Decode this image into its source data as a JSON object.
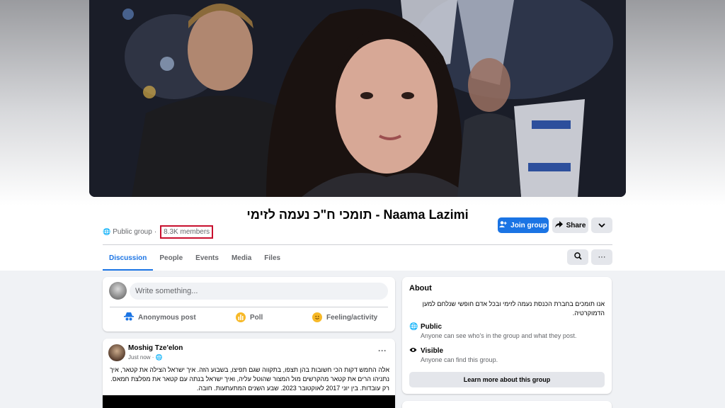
{
  "header": {
    "group_title": "תומכי ח\"כ נעמה לזימי - Naama Lazimi",
    "privacy": "Public group",
    "members": "8.3K members",
    "join_label": "Join group",
    "share_label": "Share"
  },
  "tabs": [
    {
      "label": "Discussion",
      "active": true
    },
    {
      "label": "People"
    },
    {
      "label": "Events"
    },
    {
      "label": "Media"
    },
    {
      "label": "Files"
    }
  ],
  "composer": {
    "placeholder": "Write something...",
    "actions": {
      "anonymous": "Anonymous post",
      "poll": "Poll",
      "feeling": "Feeling/activity"
    }
  },
  "post": {
    "author": "Moshig Tze'elon",
    "time": "Just now · ",
    "text": "אלה החמש דקות הכי חשובות בהן תצפו, בתקווה שגם תפיצו, בשבוע הזה. איך ישראל הצילה את קטאר, איך נתניהו הרים את קטאר מהקרשים מול המצור שהוטל עליה, ואיך ישראל בנתה עם קטאר את מפלצת חמאס. רק עובדות. בין יוני 2017 לאוקטובר 2023. שבע השנים המתעתעות. חובה."
  },
  "about": {
    "title": "About",
    "description": "אנו תומכים בחברת הכנסת נעמה לזימי ובכל אדם חופשי שנלחם למען הדמוקרטיה.",
    "public_title": "Public",
    "public_desc": "Anyone can see who's in the group and what they post.",
    "visible_title": "Visible",
    "visible_desc": "Anyone can find this group.",
    "learn_more": "Learn more about this group"
  },
  "colors": {
    "accent": "#1b74e4",
    "highlight_box": "#c8102e",
    "background": "#f0f2f5"
  },
  "icons": [
    "globe-icon",
    "add-person-icon",
    "share-arrow-icon",
    "chevron-down-icon",
    "search-icon",
    "more-icon",
    "anonymous-icon",
    "poll-icon",
    "smiley-icon",
    "eye-icon"
  ]
}
